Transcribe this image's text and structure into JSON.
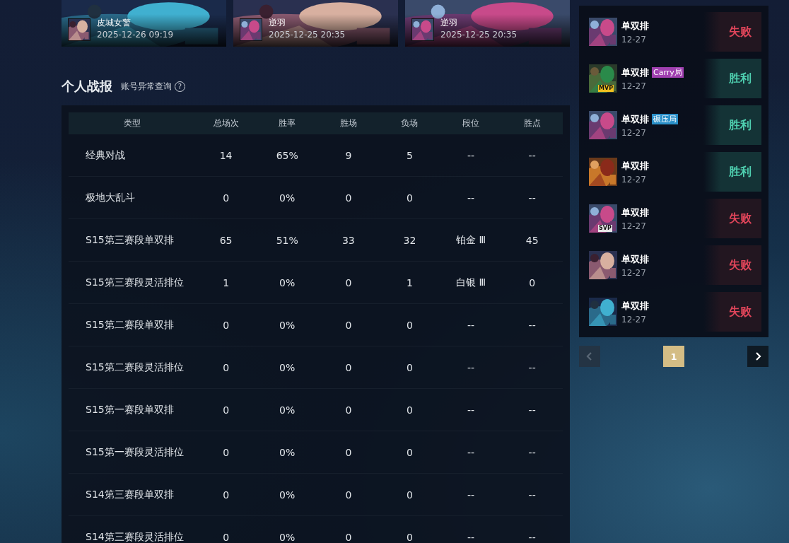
{
  "videos": [
    {
      "title": "皮城女警",
      "time": "2025-12-26 09:19"
    },
    {
      "title": "逆羽",
      "time": "2025-12-25 20:35"
    },
    {
      "title": "逆羽",
      "time": "2025-12-25 20:35"
    }
  ],
  "section": {
    "title": "个人战报",
    "link": "账号异常查询",
    "help": "?"
  },
  "table": {
    "columns": [
      "类型",
      "总场次",
      "胜率",
      "胜场",
      "负场",
      "段位",
      "胜点"
    ],
    "rows": [
      [
        "经典对战",
        "14",
        "65%",
        "9",
        "5",
        "--",
        "--"
      ],
      [
        "极地大乱斗",
        "0",
        "0%",
        "0",
        "0",
        "--",
        "--"
      ],
      [
        "S15第三赛段单双排",
        "65",
        "51%",
        "33",
        "32",
        "铂金 Ⅲ",
        "45"
      ],
      [
        "S15第三赛段灵活排位",
        "1",
        "0%",
        "0",
        "1",
        "白银 Ⅲ",
        "0"
      ],
      [
        "S15第二赛段单双排",
        "0",
        "0%",
        "0",
        "0",
        "--",
        "--"
      ],
      [
        "S15第二赛段灵活排位",
        "0",
        "0%",
        "0",
        "0",
        "--",
        "--"
      ],
      [
        "S15第一赛段单双排",
        "0",
        "0%",
        "0",
        "0",
        "--",
        "--"
      ],
      [
        "S15第一赛段灵活排位",
        "0",
        "0%",
        "0",
        "0",
        "--",
        "--"
      ],
      [
        "S14第三赛段单双排",
        "0",
        "0%",
        "0",
        "0",
        "--",
        "--"
      ],
      [
        "S14第三赛段灵活排位",
        "0",
        "0%",
        "0",
        "0",
        "--",
        "--"
      ]
    ]
  },
  "matches": [
    {
      "mode": "单双排",
      "date": "12-27",
      "result": "失败",
      "kind": "loss"
    },
    {
      "mode": "单双排",
      "date": "12-27",
      "result": "胜利",
      "kind": "win",
      "badge": "MVP",
      "tag": {
        "text": "Carry局",
        "color": "#a040b0"
      }
    },
    {
      "mode": "单双排",
      "date": "12-27",
      "result": "胜利",
      "kind": "win",
      "tag": {
        "text": "碾压局",
        "color": "#2a8fc8"
      }
    },
    {
      "mode": "单双排",
      "date": "12-27",
      "result": "胜利",
      "kind": "win"
    },
    {
      "mode": "单双排",
      "date": "12-27",
      "result": "失败",
      "kind": "loss",
      "badge": "SVP"
    },
    {
      "mode": "单双排",
      "date": "12-27",
      "result": "失败",
      "kind": "loss"
    },
    {
      "mode": "单双排",
      "date": "12-27",
      "result": "失败",
      "kind": "loss"
    }
  ],
  "pagination": {
    "prev_disabled": true,
    "pages": [
      {
        "label": "1",
        "selected": true
      }
    ],
    "next_disabled": false
  }
}
